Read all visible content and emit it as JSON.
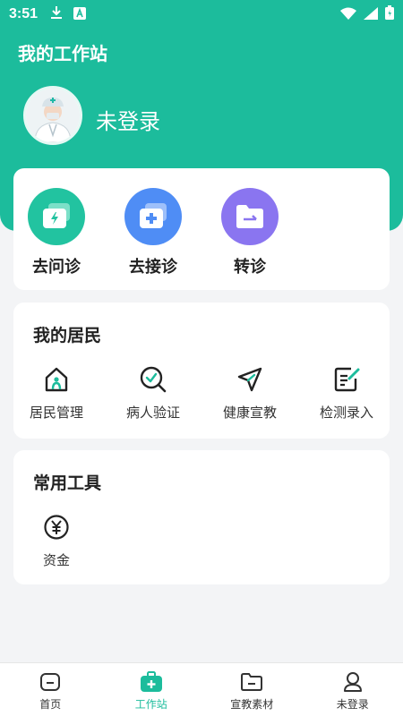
{
  "status_bar": {
    "time": "3:51"
  },
  "header": {
    "title": "我的工作站",
    "username": "未登录"
  },
  "quick_actions": [
    {
      "label": "去问诊",
      "icon": "lightning-card-icon",
      "color": "#22c3a0"
    },
    {
      "label": "去接诊",
      "icon": "medical-plus-icon",
      "color": "#4f8df5"
    },
    {
      "label": "转诊",
      "icon": "folder-transfer-icon",
      "color": "#8a75f0"
    }
  ],
  "residents": {
    "title": "我的居民",
    "items": [
      {
        "label": "居民管理",
        "icon": "house-person-icon"
      },
      {
        "label": "病人验证",
        "icon": "search-check-icon"
      },
      {
        "label": "健康宣教",
        "icon": "send-icon"
      },
      {
        "label": "检测录入",
        "icon": "edit-document-icon"
      }
    ]
  },
  "tools": {
    "title": "常用工具",
    "items": [
      {
        "label": "资金",
        "icon": "yuan-icon"
      }
    ]
  },
  "tabbar": [
    {
      "label": "首页",
      "icon": "home-icon",
      "active": false
    },
    {
      "label": "工作站",
      "icon": "medical-kit-icon",
      "active": true
    },
    {
      "label": "宣教素材",
      "icon": "folder-icon",
      "active": false
    },
    {
      "label": "未登录",
      "icon": "user-icon",
      "active": false
    }
  ],
  "colors": {
    "primary": "#1cbc9c",
    "background": "#f3f4f6"
  }
}
